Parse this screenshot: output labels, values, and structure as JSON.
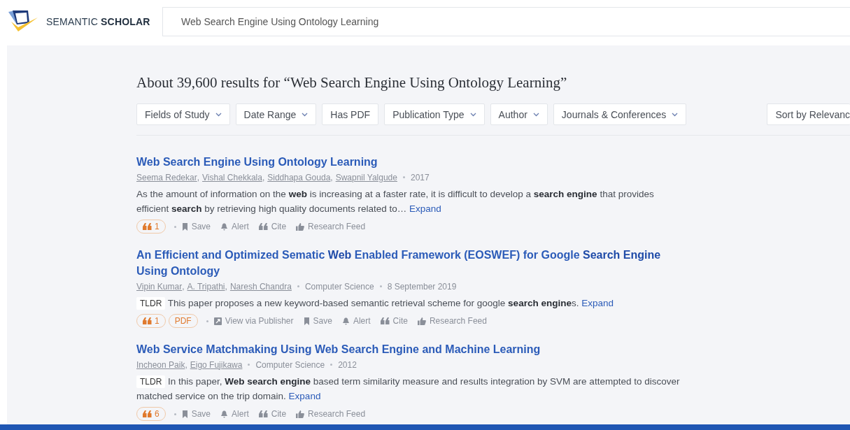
{
  "header": {
    "brand_light": "SEMANTIC",
    "brand_bold": "SCHOLAR",
    "search": {
      "value": "Web Search Engine Using Ontology Learning"
    }
  },
  "results_heading": "About 39,600 results for “Web Search Engine Using Ontology Learning”",
  "filters": [
    {
      "label": "Fields of Study",
      "dropdown": true
    },
    {
      "label": "Date Range",
      "dropdown": true
    },
    {
      "label": "Has PDF",
      "dropdown": false
    },
    {
      "label": "Publication Type",
      "dropdown": true
    },
    {
      "label": "Author",
      "dropdown": true
    },
    {
      "label": "Journals & Conferences",
      "dropdown": true
    }
  ],
  "sort": {
    "label": "Sort by Relevanc"
  },
  "results": [
    {
      "title": "Web Search Engine Using Ontology Learning",
      "authors": [
        "Seema Redekar",
        "Vishal Chekkala",
        "Siddhapa Gouda",
        "Swapnil Yalgude"
      ],
      "author_separator": ",",
      "meta": [
        "2017"
      ],
      "snippet": "As the amount of information on the **web** is increasing at a faster rate, it is difficult to develop a **search engine** that provides efficient **search** by retrieving high quality documents related to…",
      "expand": "Expand",
      "actions": [
        {
          "kind": "citations",
          "label": "1"
        },
        {
          "kind": "save",
          "label": "Save"
        },
        {
          "kind": "alert",
          "label": "Alert"
        },
        {
          "kind": "cite",
          "label": "Cite"
        },
        {
          "kind": "feed",
          "label": "Research Feed"
        }
      ]
    },
    {
      "title": "An Efficient and Optimized Sematic **Web** Enabled Framework (EOSWEF) for Google **Search Engine** Using Ontology",
      "authors": [
        "Vipin Kumar",
        "A. Tripathi",
        "Naresh Chandra"
      ],
      "author_separator": ",",
      "meta": [
        "Computer Science",
        "8 September 2019"
      ],
      "tldr_label": "TLDR",
      "snippet": "This paper proposes a new keyword-based semantic retrieval scheme for google **search engine**s.",
      "expand": "Expand",
      "actions": [
        {
          "kind": "citations",
          "label": "1"
        },
        {
          "kind": "pdf",
          "label": "PDF"
        },
        {
          "kind": "publisher",
          "label": "View via Publisher"
        },
        {
          "kind": "save",
          "label": "Save"
        },
        {
          "kind": "alert",
          "label": "Alert"
        },
        {
          "kind": "cite",
          "label": "Cite"
        },
        {
          "kind": "feed",
          "label": "Research Feed"
        }
      ]
    },
    {
      "title": "Web Service Matchmaking Using Web Search Engine and Machine Learning",
      "authors": [
        "Incheon Paik",
        "Eigo Fujikawa"
      ],
      "author_separator": ",",
      "meta": [
        "Computer Science",
        "2012"
      ],
      "tldr_label": "TLDR",
      "snippet": "In this paper, **Web search engine** based term similarity measure and results integration by SVM are attempted to discover matched service on the trip domain.",
      "expand": "Expand",
      "actions": [
        {
          "kind": "citations",
          "label": "6"
        },
        {
          "kind": "save",
          "label": "Save"
        },
        {
          "kind": "alert",
          "label": "Alert"
        },
        {
          "kind": "cite",
          "label": "Cite"
        },
        {
          "kind": "feed",
          "label": "Research Feed"
        }
      ]
    }
  ]
}
